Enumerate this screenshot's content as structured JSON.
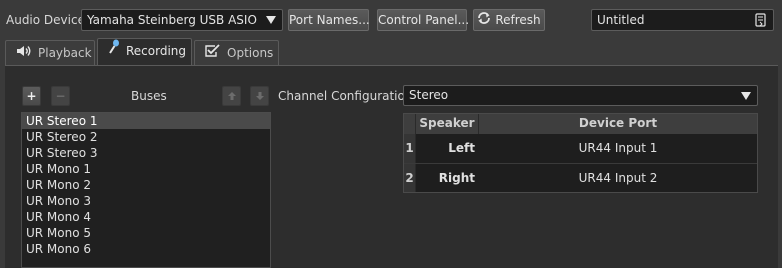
{
  "toolbar": {
    "audio_device_label": "Audio Device",
    "audio_device_value": "Yamaha Steinberg USB ASIO",
    "port_names_label": "Port Names...",
    "control_panel_label": "Control Panel...",
    "refresh_label": "Refresh",
    "preset_name": "Untitled"
  },
  "tabs": [
    {
      "label": "Playback",
      "icon": "speaker-icon",
      "active": false
    },
    {
      "label": "Recording",
      "icon": "microphone-icon",
      "active": true
    },
    {
      "label": "Options",
      "icon": "checkbox-icon",
      "active": false
    }
  ],
  "buses": {
    "header": "Buses",
    "items": [
      "UR Stereo 1",
      "UR Stereo 2",
      "UR Stereo 3",
      "UR Mono 1",
      "UR Mono 2",
      "UR Mono 3",
      "UR Mono 4",
      "UR Mono 5",
      "UR Mono 6"
    ],
    "selected_index": 0
  },
  "channel_config": {
    "label": "Channel Configuration",
    "value": "Stereo"
  },
  "speaker_table": {
    "columns": [
      "Speaker",
      "Device Port"
    ],
    "rows": [
      {
        "num": "1",
        "speaker": "Left",
        "port": "UR44 Input 1"
      },
      {
        "num": "2",
        "speaker": "Right",
        "port": "UR44 Input 2"
      }
    ]
  },
  "colors": {
    "background": "#3a3a3a",
    "panel": "#2d2d2d",
    "list_bg": "#202020",
    "selected_row": "#4a4a4a"
  }
}
